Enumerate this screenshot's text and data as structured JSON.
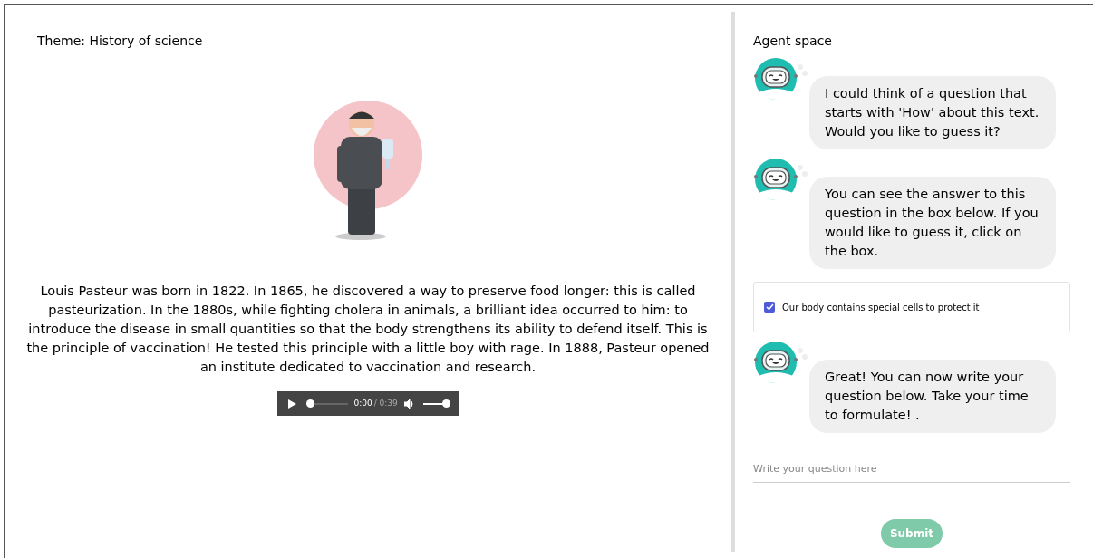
{
  "theme": {
    "label": "Theme: History of science"
  },
  "passage": "Louis Pasteur was born in 1822. In 1865, he discovered a way to preserve food longer: this is called pasteurization. In the 1880s, while fighting cholera in animals, a brilliant idea occurred to him: to introduce the disease in small quantities so that the body strengthens its ability to defend itself. This is the principle of vaccination! He tested this principle with a little boy with rage. In 1888, Pasteur opened an institute dedicated to vaccination and research.",
  "audio": {
    "current": "0:00",
    "duration": "/ 0:39",
    "progress": {
      "level": 0
    },
    "volume": {
      "level": 1
    }
  },
  "agent": {
    "title": "Agent space",
    "items": [
      {
        "kind": "message",
        "text": "I could think of a question that starts with 'How' about this text. Would you like to guess it?"
      },
      {
        "kind": "message",
        "text": "You can see the answer to this question in the box below. If you would like to guess it, click on the box."
      },
      {
        "kind": "answer",
        "text": "Our body contains special cells to protect it",
        "checked": true
      },
      {
        "kind": "message",
        "text": "Great! You can now write your question below. Take your time to formulate! ."
      }
    ],
    "question_field": {
      "placeholder": "Write your question here"
    },
    "submit": {
      "label": "Submit",
      "disabled": true
    }
  }
}
